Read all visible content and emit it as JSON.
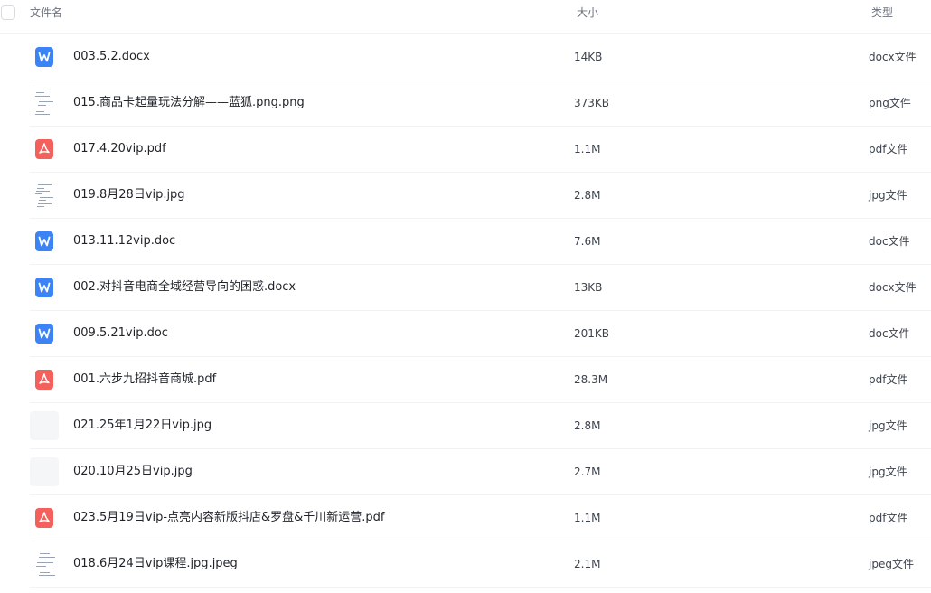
{
  "header": {
    "name_label": "文件名",
    "size_label": "大小",
    "type_label": "类型"
  },
  "files": [
    {
      "name": "003.5.2.docx",
      "size": "14KB",
      "type": "docx文件",
      "icon": "word-file-icon"
    },
    {
      "name": "015.商品卡起量玩法分解——蓝狐.png.png",
      "size": "373KB",
      "type": "png文件",
      "icon": "image-thumbnail"
    },
    {
      "name": "017.4.20vip.pdf",
      "size": "1.1M",
      "type": "pdf文件",
      "icon": "pdf-file-icon"
    },
    {
      "name": "019.8月28日vip.jpg",
      "size": "2.8M",
      "type": "jpg文件",
      "icon": "image-thumbnail"
    },
    {
      "name": "013.11.12vip.doc",
      "size": "7.6M",
      "type": "doc文件",
      "icon": "word-file-icon"
    },
    {
      "name": "002.对抖音电商全域经营导向的困惑.docx",
      "size": "13KB",
      "type": "docx文件",
      "icon": "word-file-icon"
    },
    {
      "name": "009.5.21vip.doc",
      "size": "201KB",
      "type": "doc文件",
      "icon": "word-file-icon"
    },
    {
      "name": "001.六步九招抖音商城.pdf",
      "size": "28.3M",
      "type": "pdf文件",
      "icon": "pdf-file-icon"
    },
    {
      "name": "021.25年1月22日vip.jpg",
      "size": "2.8M",
      "type": "jpg文件",
      "icon": "image-thumbnail-blank"
    },
    {
      "name": "020.10月25日vip.jpg",
      "size": "2.7M",
      "type": "jpg文件",
      "icon": "image-thumbnail-blank"
    },
    {
      "name": "023.5月19日vip-点亮内容新版抖店&罗盘&千川新运营.pdf",
      "size": "1.1M",
      "type": "pdf文件",
      "icon": "pdf-file-icon"
    },
    {
      "name": "018.6月24日vip课程.jpg.jpeg",
      "size": "2.1M",
      "type": "jpeg文件",
      "icon": "image-thumbnail"
    }
  ],
  "colors": {
    "word_icon": "#3c83f6",
    "pdf_icon": "#f4605b",
    "divider": "#f1f2f4",
    "header_text": "#6b717c"
  }
}
